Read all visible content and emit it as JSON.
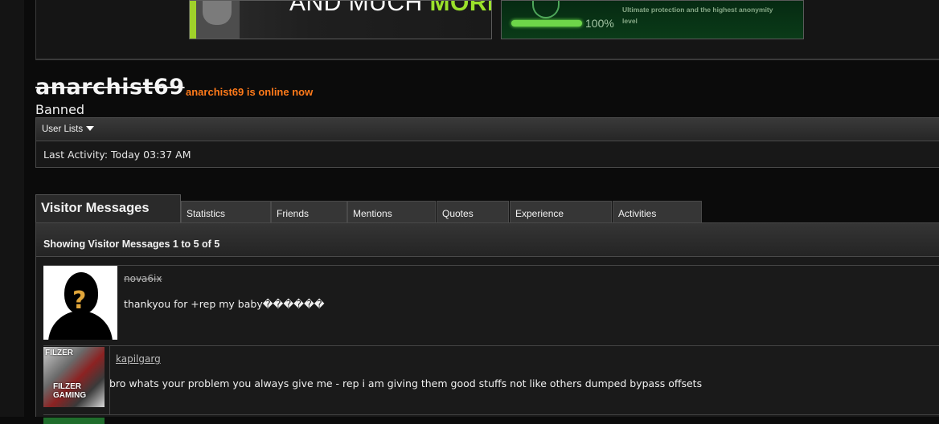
{
  "banner": {
    "left_ad_text_part1": "AND MUCH ",
    "left_ad_text_part2": "MORE!",
    "right_ad_progress": "100%",
    "right_ad_text": "Ultimate protection and the highest anonymity level",
    "right_ad_progress_fraction": 1.0
  },
  "profile": {
    "username": "anarchist69",
    "online_status": "anarchist69 is online now",
    "user_title": "Banned",
    "user_lists_label": "User Lists",
    "last_activity": "Last Activity: Today 03:37 AM"
  },
  "tabs": [
    {
      "label": "Visitor Messages",
      "active": true
    },
    {
      "label": "Statistics"
    },
    {
      "label": "Friends"
    },
    {
      "label": "Mentions"
    },
    {
      "label": "Quotes"
    },
    {
      "label": "Experience"
    },
    {
      "label": "Activities"
    }
  ],
  "visitor_messages": {
    "header": "Showing Visitor Messages 1 to 5 of 5",
    "messages": [
      {
        "author": "nova6ix",
        "author_banned": true,
        "text": "thankyou for +rep my baby������",
        "avatar_text": "?"
      },
      {
        "author": "kapilgarg",
        "author_banned": false,
        "text": "bro whats your problem you always give me - rep i am giving them good stuffs not like others dumped bypass offsets",
        "avatar_text_top": "FILZER",
        "avatar_text_bottom": "FILZER GAMING"
      }
    ]
  },
  "colors": {
    "online_status": "#ff7a1a",
    "ad_accent_green": "#9be12b",
    "background": "#0b0b0b"
  }
}
